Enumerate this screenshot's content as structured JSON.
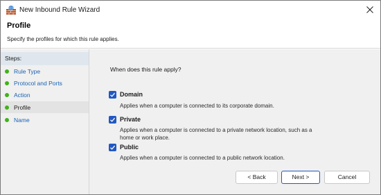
{
  "window": {
    "title": "New Inbound Rule Wizard"
  },
  "header": {
    "title": "Profile",
    "subtitle": "Specify the profiles for which this rule applies."
  },
  "steps": {
    "heading": "Steps:",
    "items": [
      {
        "label": "Rule Type",
        "state": "done"
      },
      {
        "label": "Protocol and Ports",
        "state": "done"
      },
      {
        "label": "Action",
        "state": "done"
      },
      {
        "label": "Profile",
        "state": "current"
      },
      {
        "label": "Name",
        "state": "pending"
      }
    ]
  },
  "main": {
    "question": "When does this rule apply?",
    "options": [
      {
        "label": "Domain",
        "checked": true,
        "description": "Applies when a computer is connected to its corporate domain."
      },
      {
        "label": "Private",
        "checked": true,
        "description": "Applies when a computer is connected to a private network location, such as a home or work place."
      },
      {
        "label": "Public",
        "checked": true,
        "description": "Applies when a computer is connected to a public network location."
      }
    ]
  },
  "buttons": {
    "back": "< Back",
    "next": "Next >",
    "cancel": "Cancel"
  },
  "colors": {
    "accent": "#2158c2",
    "step_dot": "#40b21a",
    "step_link": "#1a62b3"
  },
  "icons": {
    "app": "firewall-wall-icon",
    "close": "close-icon",
    "step": "green-dot-icon",
    "checkbox": "checkmark-icon"
  }
}
